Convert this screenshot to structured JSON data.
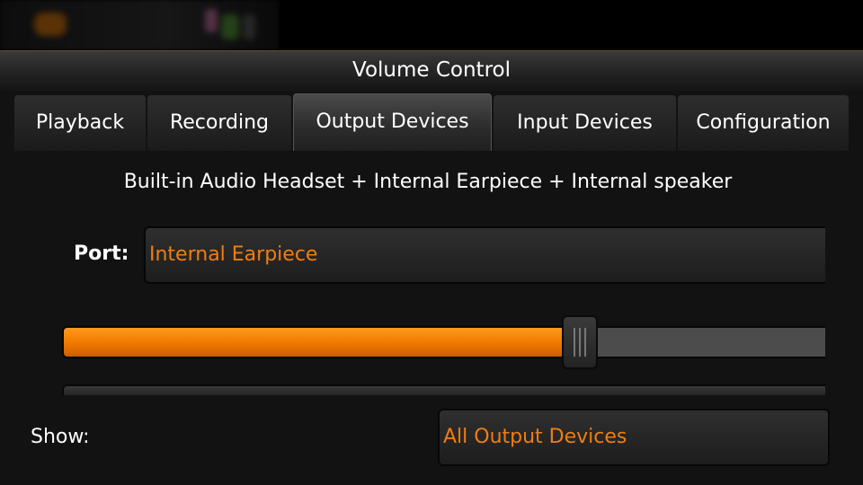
{
  "window": {
    "title": "Volume Control"
  },
  "tabs": [
    {
      "label": "Playback",
      "active": false
    },
    {
      "label": "Recording",
      "active": false
    },
    {
      "label": "Output Devices",
      "active": true
    },
    {
      "label": "Input Devices",
      "active": false
    },
    {
      "label": "Configuration",
      "active": false
    }
  ],
  "device": {
    "name": "Built-in Audio Headset + Internal Earpiece + Internal speaker",
    "port_label": "Port:",
    "port_value": "Internal Earpiece",
    "volume_fraction": 0.67
  },
  "footer": {
    "show_label": "Show:",
    "show_value": "All Output Devices"
  },
  "colors": {
    "accent": "#f07d12",
    "background": "#121212"
  }
}
